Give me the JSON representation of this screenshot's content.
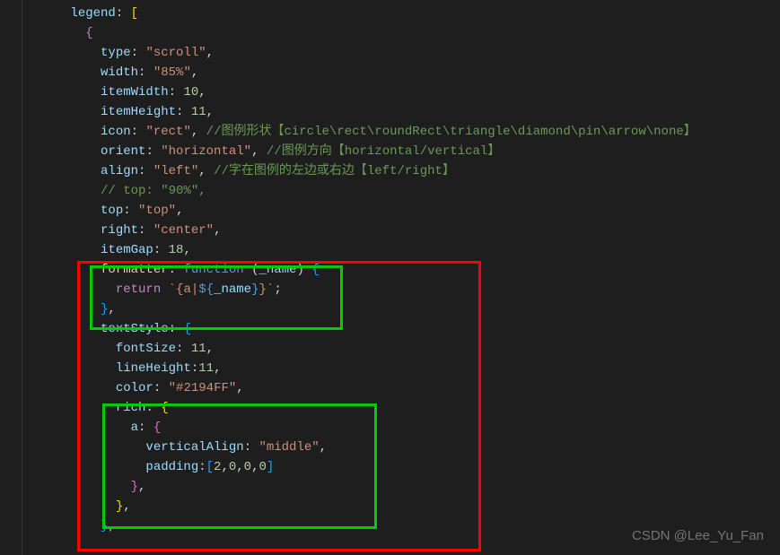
{
  "lines": {
    "l1": {
      "a": "legend",
      "b": ": ",
      "c": "["
    },
    "l2": {
      "a": "{"
    },
    "l3": {
      "a": "type",
      "b": ": ",
      "c": "\"scroll\"",
      "d": ","
    },
    "l4": {
      "a": "width",
      "b": ": ",
      "c": "\"85%\"",
      "d": ","
    },
    "l5": {
      "a": "itemWidth",
      "b": ": ",
      "c": "10",
      "d": ","
    },
    "l6": {
      "a": "itemHeight",
      "b": ": ",
      "c": "11",
      "d": ","
    },
    "l7": {
      "a": "icon",
      "b": ": ",
      "c": "\"rect\"",
      "d": ", ",
      "e": "//图例形状【circle\\rect\\roundRect\\triangle\\diamond\\pin\\arrow\\none】"
    },
    "l8": {
      "a": "orient",
      "b": ": ",
      "c": "\"horizontal\"",
      "d": ", ",
      "e": "//图例方向【horizontal/vertical】"
    },
    "l9": {
      "a": "align",
      "b": ": ",
      "c": "\"left\"",
      "d": ", ",
      "e": "//字在图例的左边或右边【left/right】"
    },
    "l10": {
      "a": "// top: \"90%\","
    },
    "l11": {
      "a": "top",
      "b": ": ",
      "c": "\"top\"",
      "d": ","
    },
    "l12": {
      "a": "right",
      "b": ": ",
      "c": "\"center\"",
      "d": ","
    },
    "l13": {
      "a": "itemGap",
      "b": ": ",
      "c": "18",
      "d": ","
    },
    "l14": {
      "a": "formatter",
      "b": ": ",
      "c": "function",
      "d": " (",
      "e": "_name",
      "f": ") ",
      "g": "{"
    },
    "l15": {
      "a": "return",
      "b": " ",
      "c": "`{a|",
      "d": "${",
      "e": "_name",
      "f": "}",
      "g": "}`",
      "h": ";"
    },
    "l16": {
      "a": "}",
      "b": ","
    },
    "l17": {
      "a": "textStyle",
      "b": ": ",
      "c": "{"
    },
    "l18": {
      "a": "fontSize",
      "b": ": ",
      "c": "11",
      "d": ","
    },
    "l19": {
      "a": "lineHeight",
      "b": ":",
      "c": "11",
      "d": ","
    },
    "l20": {
      "a": "color",
      "b": ": ",
      "c": "\"#2194FF\"",
      "d": ","
    },
    "l21": {
      "a": "rich",
      "b": ": ",
      "c": "{"
    },
    "l22": {
      "a": "a",
      "b": ": ",
      "c": "{"
    },
    "l23": {
      "a": "verticalAlign",
      "b": ": ",
      "c": "\"middle\"",
      "d": ","
    },
    "l24": {
      "a": "padding",
      "b": ":",
      "c": "[",
      "d": "2",
      "e": ",",
      "f": "0",
      "g": ",",
      "h": "0",
      "i": ",",
      "j": "0",
      "k": "]"
    },
    "l25": {
      "a": "}",
      "b": ","
    },
    "l26": {
      "a": "}",
      "b": ","
    },
    "l27": {
      "a": "}",
      "b": ","
    }
  },
  "watermark": "CSDN @Lee_Yu_Fan"
}
